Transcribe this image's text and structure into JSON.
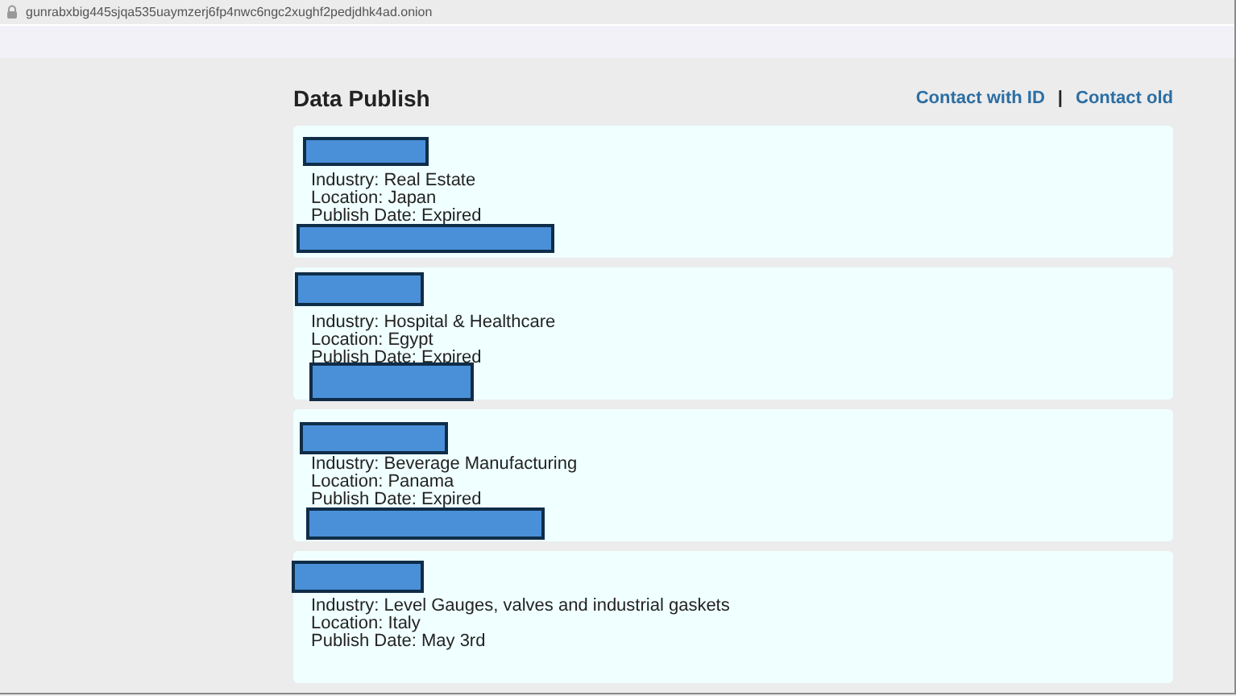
{
  "address_bar": {
    "url": "gunrabxbig445sjqa535uaymzerj6fp4nwc6ngc2xughf2pedjdhk4ad.onion"
  },
  "header": {
    "title": "Data Publish",
    "links": [
      "Contact with ID",
      "Contact old"
    ],
    "separator": "|"
  },
  "cards": [
    {
      "lines": [
        "Industry: Real Estate",
        "Location: Japan",
        "Publish Date: Expired"
      ]
    },
    {
      "lines": [
        "Industry: Hospital & Healthcare",
        "Location: Egypt",
        "Publish Date: Expired"
      ]
    },
    {
      "lines": [
        "Industry: Beverage Manufacturing",
        "Location: Panama",
        "Publish Date: Expired"
      ]
    },
    {
      "lines": [
        "Industry: Level Gauges, valves and industrial gaskets",
        "Location: Italy",
        "Publish Date: May 3rd"
      ]
    }
  ]
}
